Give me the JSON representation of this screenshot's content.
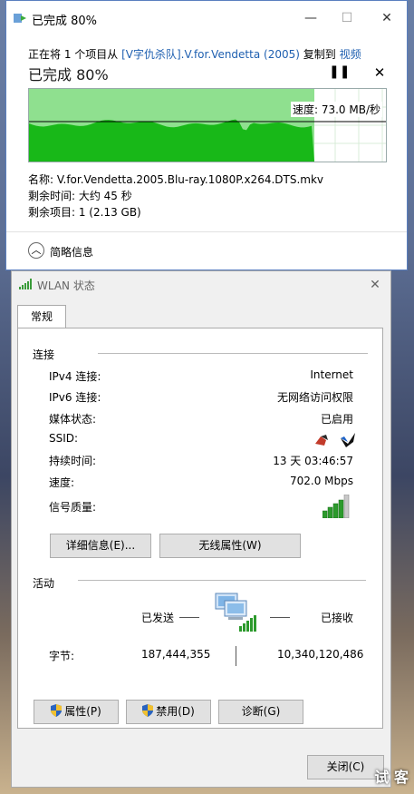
{
  "copy_window": {
    "title": "已完成 80%",
    "desc_prefix": "正在将 1 个项目从",
    "source": "[V字仇杀队].V.for.Vendetta (2005)",
    "desc_middle": "复制到",
    "destination": "视频",
    "progress_title": "已完成 80%",
    "progress_fraction": 0.8,
    "pause_icon": "pause-icon",
    "cancel_icon": "close-icon",
    "speed_label": "速度: 73.0 MB/秒",
    "name_line": "名称: V.for.Vendetta.2005.Blu-ray.1080P.x264.DTS.mkv",
    "time_left": "剩余时间: 大约 45 秒",
    "items_left": "剩余项目: 1 (2.13 GB)",
    "less_details": "简略信息",
    "minimize_glyph": "—",
    "maximize_glyph": "☐",
    "close_glyph": "✕",
    "colors": {
      "fill": "#8fe08f",
      "area": "#18b818",
      "line": "#000000",
      "link": "#1e5fb0"
    }
  },
  "wlan_window": {
    "title": "WLAN 状态",
    "close_glyph": "✕",
    "tab_general": "常规",
    "connection_group": "连接",
    "rows": [
      {
        "label": "IPv4 连接:",
        "value": "Internet"
      },
      {
        "label": "IPv6 连接:",
        "value": "无网络访问权限"
      },
      {
        "label": "媒体状态:",
        "value": "已启用"
      },
      {
        "label": "SSID:",
        "value": ""
      },
      {
        "label": "持续时间:",
        "value": "13 天 03:46:57"
      },
      {
        "label": "速度:",
        "value": "702.0 Mbps"
      },
      {
        "label": "信号质量:",
        "value": ""
      }
    ],
    "details_button": "详细信息(E)...",
    "wireless_props_button": "无线属性(W)",
    "activity_group": "活动",
    "sent_label": "已发送",
    "received_label": "已接收",
    "bytes_label": "字节:",
    "bytes_sent": "187,444,355",
    "bytes_received": "10,340,120,486",
    "properties_button": "属性(P)",
    "disable_button": "禁用(D)",
    "diagnose_button": "诊断(G)",
    "close_button": "关闭(C)"
  },
  "watermark": "试 客"
}
